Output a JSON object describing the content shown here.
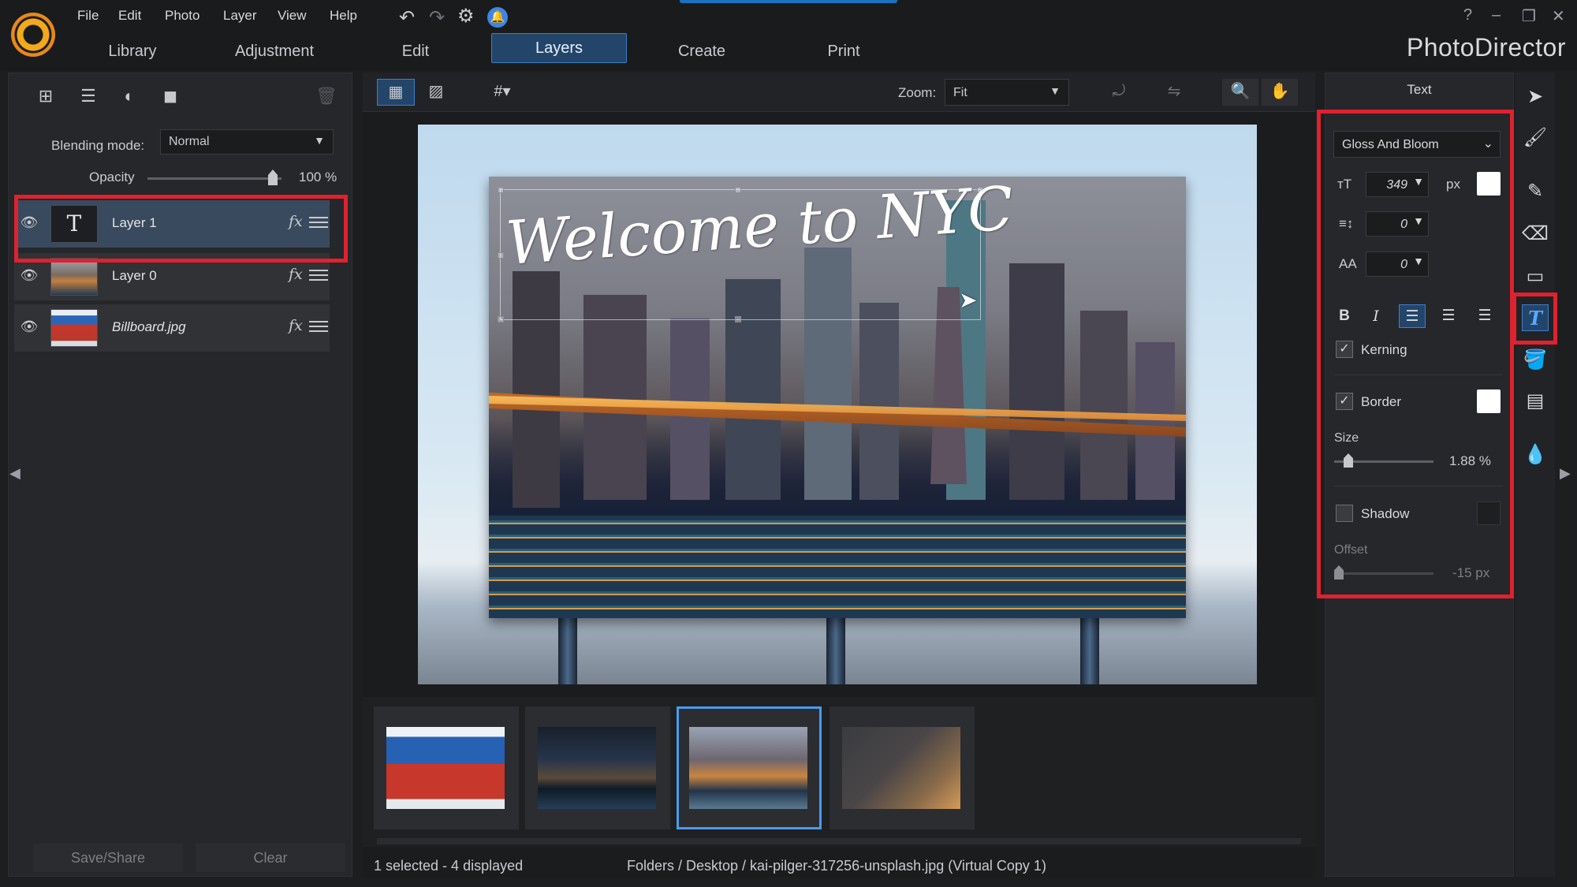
{
  "app": {
    "title": "PhotoDirector"
  },
  "menu": [
    "File",
    "Edit",
    "Photo",
    "Layer",
    "View",
    "Help"
  ],
  "modules": [
    "Library",
    "Adjustment",
    "Edit",
    "Layers",
    "Create",
    "Print"
  ],
  "window_controls": [
    "?",
    "–",
    "❐",
    "✕"
  ],
  "layers_panel": {
    "blending_label": "Blending mode:",
    "blending_value": "Normal",
    "opacity_label": "Opacity",
    "opacity_value": "100 %",
    "opacity_fraction": 1.0,
    "layers": [
      {
        "name": "Layer 1",
        "type": "text",
        "selected": true
      },
      {
        "name": "Layer 0",
        "type": "image",
        "selected": false
      },
      {
        "name": "Billboard.jpg",
        "type": "image",
        "selected": false
      }
    ],
    "fx_label": "fx",
    "save_share": "Save/Share",
    "clear": "Clear"
  },
  "toolbar": {
    "zoom_label": "Zoom:",
    "zoom_value": "Fit"
  },
  "canvas": {
    "headline": "Welcome to NYC"
  },
  "filmstrip": {
    "count": 4,
    "selected_index": 2
  },
  "status": {
    "selection": "1 selected - 4 displayed",
    "path": "Folders / Desktop / kai-pilger-317256-unsplash.jpg (Virtual Copy 1)"
  },
  "text_panel": {
    "title": "Text",
    "font": "Gloss And Bloom",
    "size_value": "349",
    "size_unit": "px",
    "line_spacing": "0",
    "char_spacing": "0",
    "bold": "B",
    "italic": "I",
    "kerning_label": "Kerning",
    "kerning_checked": true,
    "border_label": "Border",
    "border_checked": true,
    "size_label": "Size",
    "border_size": "1.88 %",
    "shadow_label": "Shadow",
    "shadow_checked": false,
    "offset_label": "Offset",
    "offset_value": "-15 px"
  },
  "colors": {
    "accent": "#3f7fc8",
    "highlight": "#e0212e",
    "text_color": "#ffffff"
  }
}
